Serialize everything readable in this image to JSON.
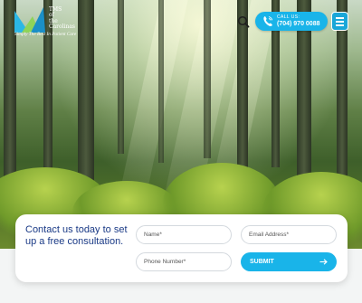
{
  "header": {
    "logo": {
      "lines": [
        "TMS",
        "of",
        "the",
        "Carolinas"
      ],
      "tagline": "Simply The Best In Patient Care"
    },
    "search_icon": "search-icon",
    "call": {
      "label": "CALL US:",
      "number": "(704) 970 0088",
      "icon": "phone-icon"
    },
    "menu_icon": "hamburger-menu-icon"
  },
  "hero": {
    "image": "sunlit forest with ferns"
  },
  "form": {
    "headline": "Contact us today to set up a free consultation.",
    "name_placeholder": "Name*",
    "email_placeholder": "Email Address*",
    "phone_placeholder": "Phone Number*",
    "submit_label": "SUBMIT",
    "submit_icon": "arrow-right-icon"
  },
  "colors": {
    "accent": "#19b4e9",
    "headline": "#1a3a86"
  }
}
